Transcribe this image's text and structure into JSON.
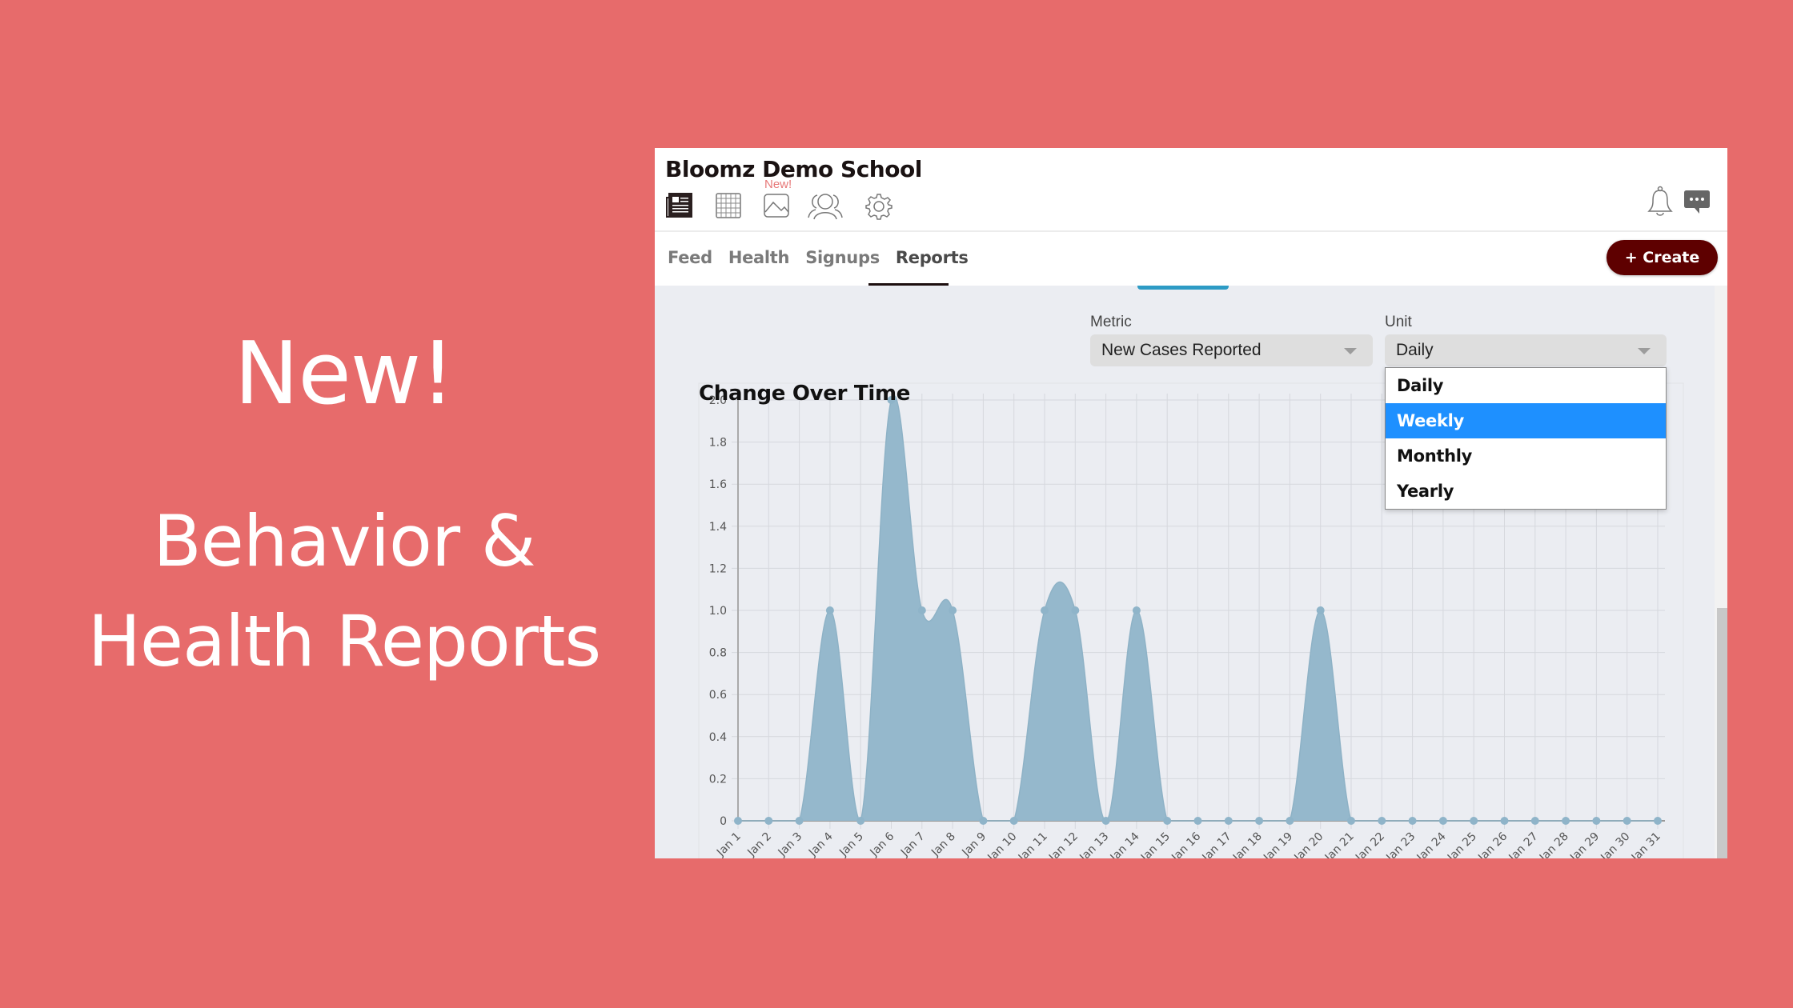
{
  "promo": {
    "headline": "New!",
    "subtitle_line1": "Behavior &",
    "subtitle_line2": "Health Reports"
  },
  "app": {
    "title": "Bloomz Demo School",
    "new_badge": "New!",
    "nav_icons": [
      {
        "name": "newspaper-icon",
        "active": true
      },
      {
        "name": "calendar-grid-icon",
        "active": false
      },
      {
        "name": "photo-icon",
        "active": false
      },
      {
        "name": "people-icon",
        "active": false
      },
      {
        "name": "gear-icon",
        "active": false
      }
    ],
    "header_right_icons": [
      "bell-icon",
      "chat-icon"
    ],
    "tabs": [
      {
        "label": "Feed",
        "active": false
      },
      {
        "label": "Health",
        "active": false
      },
      {
        "label": "Signups",
        "active": false
      },
      {
        "label": "Reports",
        "active": true
      }
    ],
    "create_button": "+ Create",
    "colors": {
      "background": "#e76b6b",
      "create_button": "#5e0000",
      "highlight": "#1e90ff",
      "chart_fill": "#95b8cc",
      "new_badge": "#e77878"
    }
  },
  "report": {
    "title": "Change Over Time",
    "metric": {
      "label": "Metric",
      "value": "New Cases Reported"
    },
    "unit": {
      "label": "Unit",
      "value": "Daily",
      "dropdown_open": true,
      "options": [
        "Daily",
        "Weekly",
        "Monthly",
        "Yearly"
      ],
      "highlighted": "Weekly"
    }
  },
  "chart_data": {
    "type": "area",
    "title": "Change Over Time",
    "xlabel": "",
    "ylabel": "",
    "categories": [
      "Jan 1",
      "Jan 2",
      "Jan 3",
      "Jan 4",
      "Jan 5",
      "Jan 6",
      "Jan 7",
      "Jan 8",
      "Jan 9",
      "Jan 10",
      "Jan 11",
      "Jan 12",
      "Jan 13",
      "Jan 14",
      "Jan 15",
      "Jan 16",
      "Jan 17",
      "Jan 18",
      "Jan 19",
      "Jan 20",
      "Jan 21",
      "Jan 22",
      "Jan 23",
      "Jan 24",
      "Jan 25",
      "Jan 26",
      "Jan 27",
      "Jan 28",
      "Jan 29",
      "Jan 30",
      "Jan 31"
    ],
    "series": [
      {
        "name": "New Cases Reported",
        "values": [
          0,
          0,
          0,
          1,
          0,
          2,
          1,
          1,
          0,
          0,
          1,
          1,
          0,
          1,
          0,
          0,
          0,
          0,
          0,
          1,
          0,
          0,
          0,
          0,
          0,
          0,
          0,
          0,
          0,
          0,
          0
        ]
      }
    ],
    "ylim": [
      0,
      2.0
    ],
    "yticks": [
      "0",
      "0.2",
      "0.4",
      "0.6",
      "0.8",
      "1.0",
      "1.2",
      "1.4",
      "1.6",
      "1.8",
      "2.0"
    ],
    "grid": true,
    "smooth": true,
    "legend": "none"
  }
}
